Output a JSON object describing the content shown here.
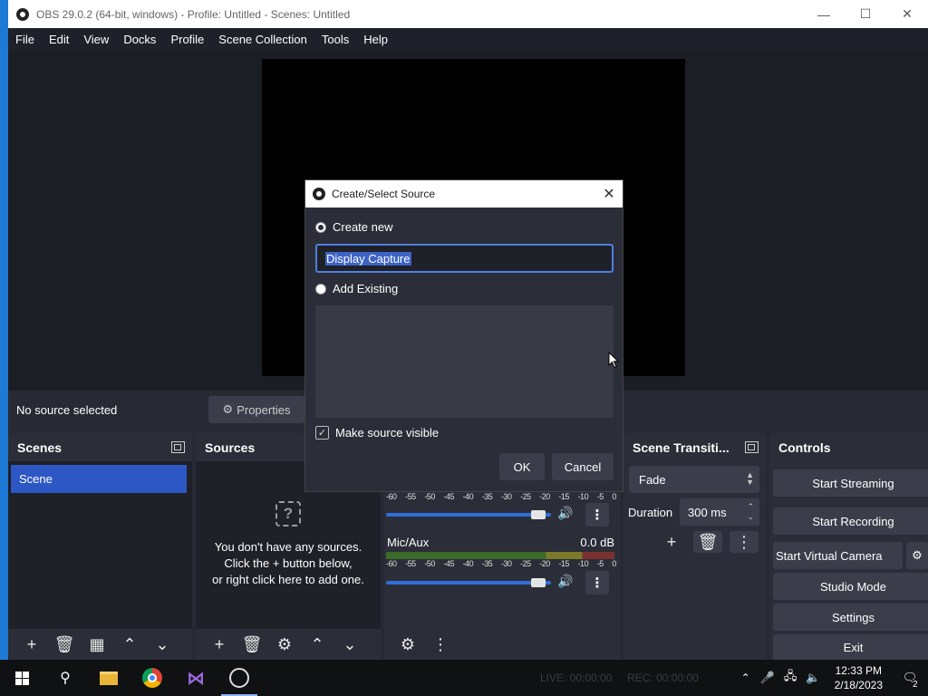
{
  "window": {
    "title": "OBS 29.0.2 (64-bit, windows) - Profile: Untitled - Scenes: Untitled",
    "min_icon": "minimize-icon",
    "max_icon": "maximize-icon",
    "close_icon": "close-icon"
  },
  "menu": [
    "File",
    "Edit",
    "View",
    "Docks",
    "Profile",
    "Scene Collection",
    "Tools",
    "Help"
  ],
  "context_bar": {
    "status": "No source selected",
    "properties_label": "Properties"
  },
  "scenes": {
    "header": "Scenes",
    "items": [
      "Scene"
    ]
  },
  "sources": {
    "header": "Sources",
    "empty_line1": "You don't have any sources.",
    "empty_line2": "Click the + button below,",
    "empty_line3": "or right click here to add one."
  },
  "mixer": {
    "scale": [
      "-60",
      "-55",
      "-50",
      "-45",
      "-40",
      "-35",
      "-30",
      "-25",
      "-20",
      "-15",
      "-10",
      "-5",
      "0"
    ],
    "channel2_name": "Mic/Aux",
    "channel2_level": "0.0 dB",
    "channel1_volume_fraction": 0.88,
    "channel2_volume_fraction": 0.88
  },
  "transitions": {
    "header": "Scene Transiti...",
    "selected": "Fade",
    "duration_label": "Duration",
    "duration_value": "300 ms"
  },
  "controls": {
    "header": "Controls",
    "start_streaming": "Start Streaming",
    "start_recording": "Start Recording",
    "start_virtual_camera": "Start Virtual Camera",
    "studio_mode": "Studio Mode",
    "settings": "Settings",
    "exit": "Exit"
  },
  "dialog": {
    "title": "Create/Select Source",
    "create_new_label": "Create new",
    "name_value": "Display Capture",
    "add_existing_label": "Add Existing",
    "make_visible_label": "Make source visible",
    "make_visible_checked": true,
    "ok_label": "OK",
    "cancel_label": "Cancel"
  },
  "taskbar": {
    "live_status": "LIVE: 00:00:00",
    "rec_status": "REC: 00:00:00",
    "time": "12:33 PM",
    "date": "2/18/2023",
    "notification_count": "2"
  }
}
